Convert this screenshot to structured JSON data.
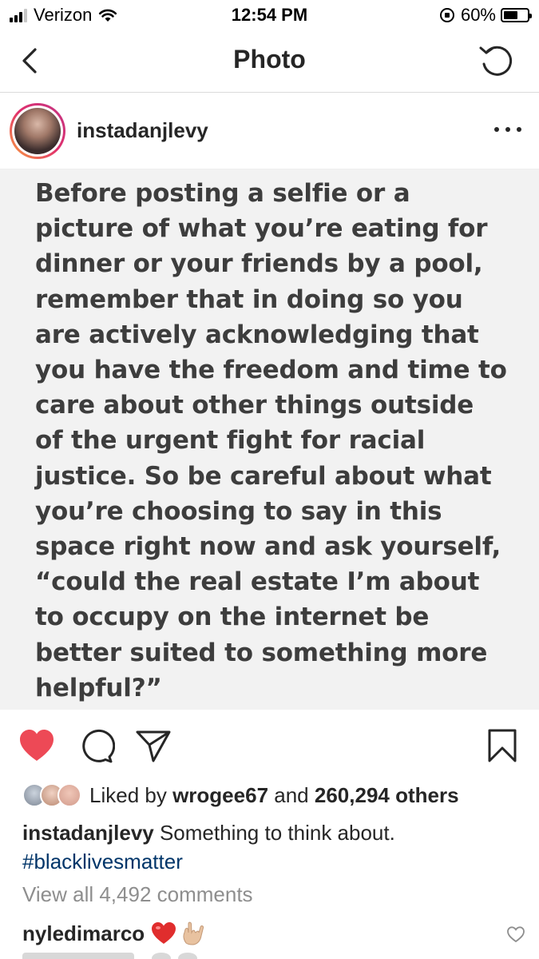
{
  "status_bar": {
    "carrier": "Verizon",
    "time": "12:54 PM",
    "battery": "60%",
    "battery_level": 0.6,
    "signal_bars_filled": 3,
    "signal_bars_total": 4
  },
  "nav": {
    "title": "Photo",
    "back_icon": "chevron-left-icon",
    "refresh_icon": "refresh-icon"
  },
  "post": {
    "username": "instadanjlevy",
    "image_text": "Before posting a selfie or a\npicture of what you’re eating for\ndinner or your friends by a pool,\nremember that in doing so you\nare actively acknowledging that\nyou have the freedom and time to\ncare about other things outside\nof the urgent fight for racial\njustice. So be careful about what\nyou’re choosing to say in this\nspace right now and ask yourself,\n“could the real estate I’m about\nto occupy on the internet be\nbetter suited to something more\nhelpful?”"
  },
  "actions": {
    "liked": true,
    "like_color": "#ed4956"
  },
  "likes": {
    "prefix": "Liked by",
    "user": "wrogee67",
    "middle": "and",
    "others": "260,294 others"
  },
  "caption": {
    "user": "instadanjlevy",
    "text": "Something to think about.",
    "hashtag": "#blacklivesmatter",
    "hashtag_color": "#003569"
  },
  "comments": {
    "view_all": "View all 4,492 comments",
    "first_user": "nyledimarco",
    "first_emojis": [
      "red-heart-emoji",
      "love-you-gesture-emoji"
    ]
  }
}
